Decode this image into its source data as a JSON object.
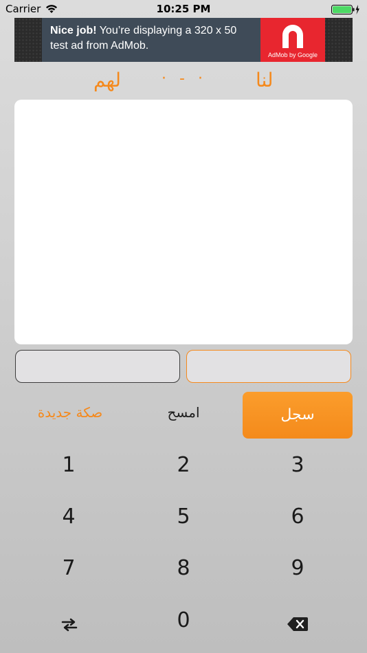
{
  "status_bar": {
    "carrier": "Carrier",
    "time": "10:25 PM",
    "icons": [
      "wifi-icon",
      "battery-icon",
      "charging-bolt-icon"
    ]
  },
  "ad": {
    "headline": "Nice job!",
    "body": "You’re displaying a 320 x 50 test ad from AdMob.",
    "logo_caption": "AdMob by Google",
    "icon": "admob-logo-icon"
  },
  "score": {
    "them_label": "لهم",
    "separator": "· - ·",
    "us_label": "لنا"
  },
  "inputs": {
    "them_value": "",
    "us_value": ""
  },
  "actions": {
    "new_game": "صكة جديدة",
    "clear": "امسح",
    "record": "سجل"
  },
  "keypad": {
    "keys": [
      "1",
      "2",
      "3",
      "4",
      "5",
      "6",
      "7",
      "8",
      "9",
      "0"
    ],
    "swap_icon": "swap-arrows-icon",
    "backspace_icon": "backspace-icon"
  },
  "colors": {
    "accent": "#f5891c",
    "ad_background": "#3f4b58",
    "ad_logo_red": "#e8262f"
  }
}
